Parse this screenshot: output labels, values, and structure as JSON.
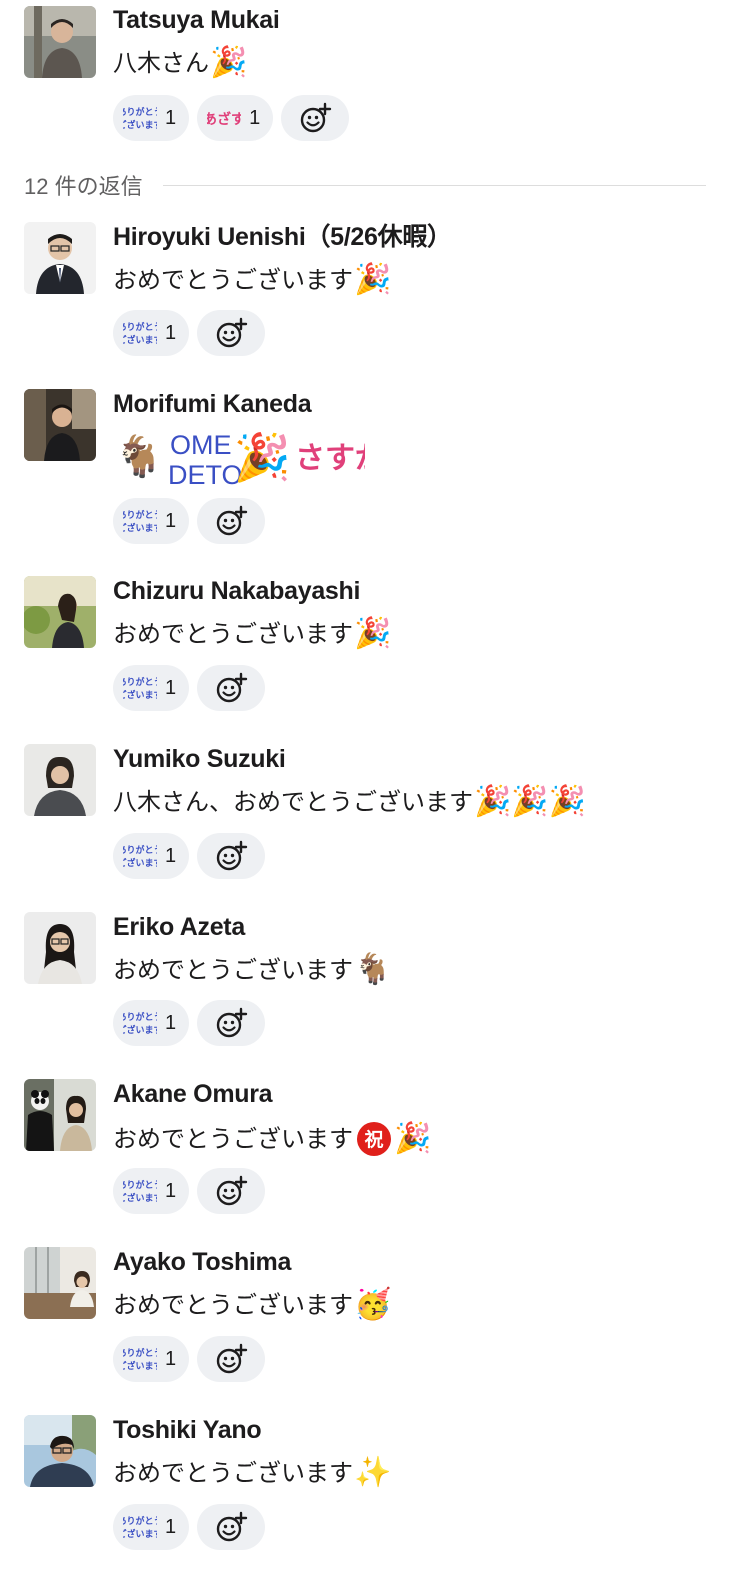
{
  "thread": {
    "root": {
      "author": "Tatsuya Mukai",
      "text": "八木さん",
      "emoji": "🎉",
      "reactions": [
        {
          "stamp": "arigatou-stamp",
          "stamp_text": [
            "ありがとう",
            "ございます"
          ],
          "count": "1"
        },
        {
          "stamp": "azasu-stamp",
          "stamp_text": [
            "あざす"
          ],
          "count": "1"
        }
      ]
    },
    "divider_label": "12 件の返信",
    "replies": [
      {
        "author": "Hiroyuki Uenishi（5/26休暇）",
        "text": "おめでとうございます",
        "emoji": "🎉",
        "reactions": [
          {
            "stamp": "arigatou-stamp",
            "count": "1"
          }
        ]
      },
      {
        "author": "Morifumi Kaneda",
        "text": "",
        "emoji": "🐐",
        "stamp_text": [
          "OME",
          "DETO"
        ],
        "stamp_text2": "さすが",
        "stamp_emoji": "🎉",
        "reactions": [
          {
            "stamp": "arigatou-stamp",
            "count": "1"
          }
        ]
      },
      {
        "author": "Chizuru Nakabayashi",
        "text": "おめでとうございます",
        "emoji": "🎉",
        "reactions": [
          {
            "stamp": "arigatou-stamp",
            "count": "1"
          }
        ]
      },
      {
        "author": "Yumiko Suzuki",
        "text": "八木さん、おめでとうございます",
        "emoji": "🎉🎉🎉",
        "reactions": [
          {
            "stamp": "arigatou-stamp",
            "count": "1"
          }
        ]
      },
      {
        "author": "Eriko Azeta",
        "text": "おめでとうございます",
        "emoji": "🐐",
        "reactions": [
          {
            "stamp": "arigatou-stamp",
            "count": "1"
          }
        ]
      },
      {
        "author": "Akane Omura",
        "text": "おめでとうございます",
        "emoji": "🎉",
        "badge": "祝",
        "reactions": [
          {
            "stamp": "arigatou-stamp",
            "count": "1"
          }
        ]
      },
      {
        "author": "Ayako Toshima",
        "text": "おめでとうございます",
        "emoji": "🥳",
        "reactions": [
          {
            "stamp": "arigatou-stamp",
            "count": "1"
          }
        ]
      },
      {
        "author": "Toshiki Yano",
        "text": "おめでとうございます",
        "emoji": "✨",
        "reactions": [
          {
            "stamp": "arigatou-stamp",
            "count": "1"
          }
        ]
      }
    ]
  },
  "colors": {
    "pill_bg": "#eef0f3",
    "stamp_blue": "#3a4fc4",
    "stamp_pink": "#e0407a",
    "divider": "#dddddd",
    "badge_red": "#e0201b"
  },
  "icons": {
    "add_reaction": "add-reaction-icon"
  }
}
